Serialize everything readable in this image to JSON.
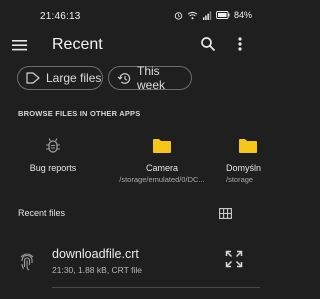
{
  "status_bar": {
    "time": "21:46:13",
    "battery": "84%"
  },
  "app_bar": {
    "title": "Recent",
    "menu_icon": "hamburger-menu-icon",
    "search_icon": "search-icon",
    "more_icon": "more-vert-icon"
  },
  "filters": {
    "large_files": "Large files",
    "this_week": "This week"
  },
  "browse_section": {
    "label": "BROWSE FILES IN OTHER APPS",
    "apps": [
      {
        "name": "Bug reports",
        "path": "",
        "icon": "bug-icon"
      },
      {
        "name": "Camera",
        "path": "/storage/emulated/0/DC...",
        "icon": "folder-icon"
      },
      {
        "name": "Domyśln",
        "path": "/storage",
        "icon": "folder-icon"
      }
    ]
  },
  "recent_section": {
    "label": "Recent files",
    "view_icon": "grid-view-icon"
  },
  "files": [
    {
      "name": "downloadfile.crt",
      "meta": "21:30, 1.88 kB, CRT file",
      "icon": "fingerprint-icon"
    }
  ],
  "colors": {
    "background": "#1f1f1f",
    "folder": "#f5c518",
    "text_primary": "#ececec",
    "text_secondary": "#b5b5b5"
  }
}
